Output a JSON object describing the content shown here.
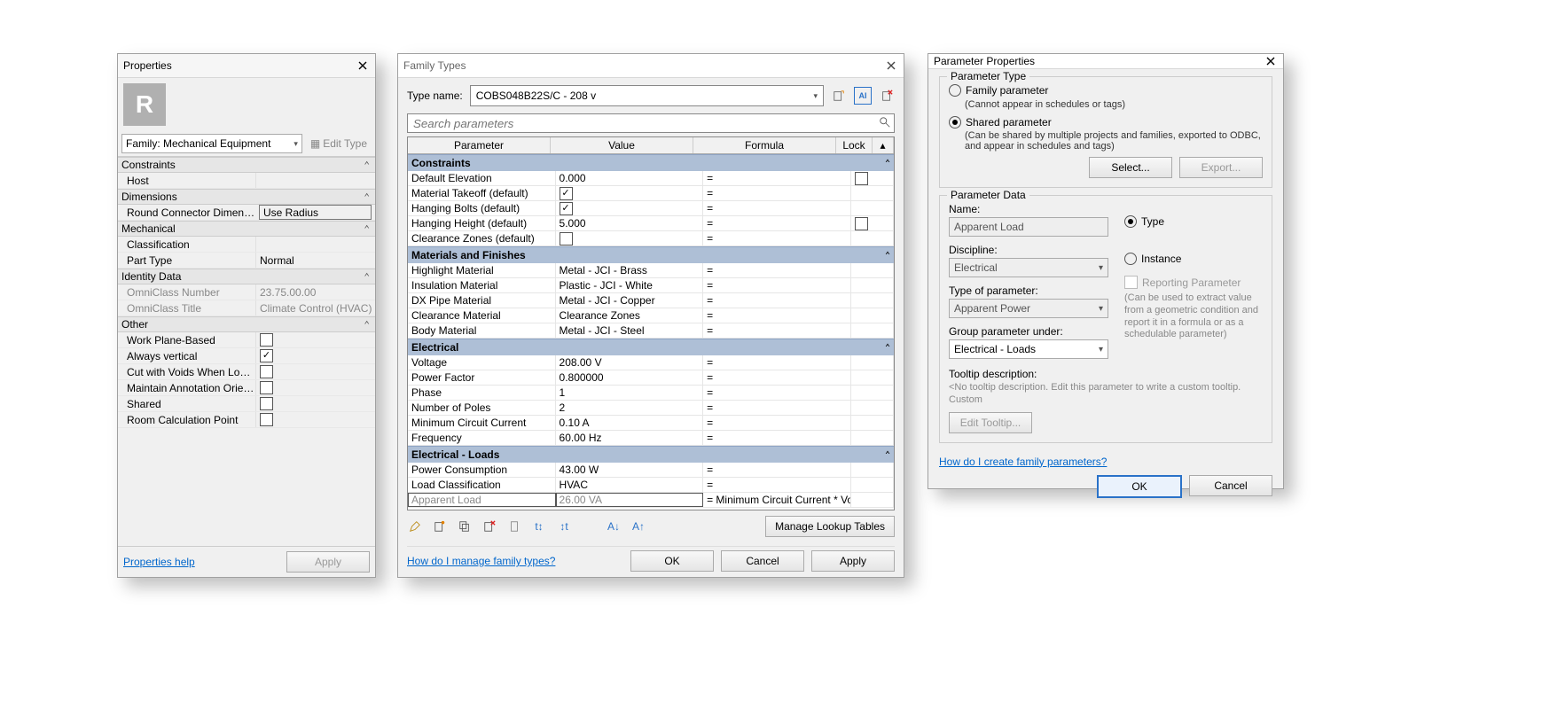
{
  "props": {
    "title": "Properties",
    "family_selector": "Family: Mechanical Equipment",
    "edit_type": "Edit Type",
    "cats": {
      "constraints": "Constraints",
      "dimensions": "Dimensions",
      "mechanical": "Mechanical",
      "identity": "Identity Data",
      "other": "Other"
    },
    "rows": {
      "host": {
        "k": "Host",
        "v": ""
      },
      "rcd": {
        "k": "Round Connector Dimensi...",
        "v": "Use Radius"
      },
      "classification": {
        "k": "Classification",
        "v": ""
      },
      "part_type": {
        "k": "Part Type",
        "v": "Normal"
      },
      "omni_num": {
        "k": "OmniClass Number",
        "v": "23.75.00.00"
      },
      "omni_title": {
        "k": "OmniClass Title",
        "v": "Climate Control (HVAC)"
      },
      "wpb": {
        "k": "Work Plane-Based"
      },
      "av": {
        "k": "Always vertical"
      },
      "cvw": {
        "k": "Cut with Voids When Load..."
      },
      "mao": {
        "k": "Maintain Annotation Orien..."
      },
      "shared": {
        "k": "Shared"
      },
      "rcp": {
        "k": "Room Calculation Point"
      }
    },
    "help": "Properties help",
    "apply": "Apply"
  },
  "ft": {
    "title": "Family Types",
    "type_name_label": "Type name:",
    "type_name_value": "COBS048B22S/C - 208 v",
    "search_placeholder": "Search parameters",
    "headers": {
      "param": "Parameter",
      "value": "Value",
      "formula": "Formula",
      "lock": "Lock"
    },
    "groups": {
      "constraints": "Constraints",
      "materials": "Materials and Finishes",
      "electrical": "Electrical",
      "eloads": "Electrical - Loads"
    },
    "rows": {
      "def_elev": {
        "p": "Default Elevation",
        "v": "0.000",
        "f": "="
      },
      "mto": {
        "p": "Material Takeoff (default)",
        "chk": true,
        "f": "="
      },
      "hb": {
        "p": "Hanging Bolts (default)",
        "chk": true,
        "f": "="
      },
      "hh": {
        "p": "Hanging Height (default)",
        "v": "5.000",
        "f": "="
      },
      "cz": {
        "p": "Clearance Zones (default)",
        "chk": false,
        "f": "="
      },
      "hm": {
        "p": "Highlight Material",
        "v": "Metal - JCI - Brass",
        "f": "="
      },
      "im": {
        "p": "Insulation Material",
        "v": "Plastic - JCI - White",
        "f": "="
      },
      "dx": {
        "p": "DX Pipe Material",
        "v": "Metal - JCI - Copper",
        "f": "="
      },
      "cm": {
        "p": "Clearance Material",
        "v": "Clearance Zones",
        "f": "="
      },
      "bm": {
        "p": "Body Material",
        "v": "Metal - JCI - Steel",
        "f": "="
      },
      "volt": {
        "p": "Voltage",
        "v": "208.00 V",
        "f": "="
      },
      "pf": {
        "p": "Power Factor",
        "v": "0.800000",
        "f": "="
      },
      "phase": {
        "p": "Phase",
        "v": "1",
        "f": "="
      },
      "np": {
        "p": "Number of Poles",
        "v": "2",
        "f": "="
      },
      "mcc": {
        "p": "Minimum Circuit Current",
        "v": "0.10 A",
        "f": "="
      },
      "freq": {
        "p": "Frequency",
        "v": "60.00 Hz",
        "f": "="
      },
      "pc": {
        "p": "Power Consumption",
        "v": "43.00 W",
        "f": "="
      },
      "lc": {
        "p": "Load Classification",
        "v": "HVAC",
        "f": "="
      },
      "al": {
        "p": "Apparent Load",
        "v": "26.00 VA",
        "f": "= Minimum Circuit Current * Volta"
      }
    },
    "manage_lookup": "Manage Lookup Tables",
    "manage_link": "How do I manage family types?",
    "ok": "OK",
    "cancel": "Cancel",
    "apply": "Apply"
  },
  "pp": {
    "title": "Parameter Properties",
    "g_type": "Parameter Type",
    "family_param": "Family parameter",
    "family_param_desc": "(Cannot appear in schedules or tags)",
    "shared_param": "Shared parameter",
    "shared_param_desc": "(Can be shared by multiple projects and families, exported to ODBC, and appear in schedules and tags)",
    "select": "Select...",
    "export": "Export...",
    "g_data": "Parameter Data",
    "name_label": "Name:",
    "name_value": "Apparent Load",
    "type_radio": "Type",
    "instance_radio": "Instance",
    "discipline_label": "Discipline:",
    "discipline_value": "Electrical",
    "typeof_label": "Type of parameter:",
    "typeof_value": "Apparent Power",
    "group_label": "Group parameter under:",
    "group_value": "Electrical - Loads",
    "reporting": "Reporting Parameter",
    "reporting_desc": "(Can be used to extract value from a geometric condition and report it in a formula or as a schedulable parameter)",
    "tooltip_label": "Tooltip description:",
    "tooltip_placeholder": "<No tooltip description. Edit this parameter to write a custom tooltip. Custom",
    "edit_tooltip": "Edit Tooltip...",
    "help_link": "How do I create family parameters?",
    "ok": "OK",
    "cancel": "Cancel"
  }
}
